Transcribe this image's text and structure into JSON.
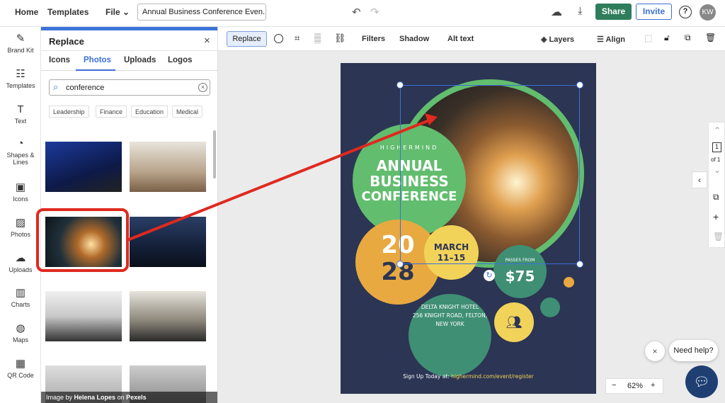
{
  "topbar": {
    "home": "Home",
    "templates": "Templates",
    "file": "File",
    "doc_name": "Annual Business Conference Even...",
    "share": "Share",
    "invite": "Invite",
    "help": "?",
    "avatar": "KW"
  },
  "rail": [
    {
      "label": "Brand Kit",
      "icon": "✎"
    },
    {
      "label": "Templates",
      "icon": "☷"
    },
    {
      "label": "Text",
      "icon": "T"
    },
    {
      "label": "Shapes & Lines",
      "icon": "◔"
    },
    {
      "label": "Icons",
      "icon": "▣"
    },
    {
      "label": "Photos",
      "icon": "▨"
    },
    {
      "label": "Uploads",
      "icon": "☁"
    },
    {
      "label": "Charts",
      "icon": "▥"
    },
    {
      "label": "Maps",
      "icon": "◍"
    },
    {
      "label": "QR Code",
      "icon": "▦"
    }
  ],
  "panel": {
    "title": "Replace",
    "tabs": [
      "Icons",
      "Photos",
      "Uploads",
      "Logos"
    ],
    "active_tab": "Photos",
    "search_value": "conference",
    "chips": [
      "Leadership",
      "Finance",
      "Education",
      "Medical"
    ],
    "credit_prefix": "Image by ",
    "credit_author": "Helena Lopes",
    "credit_mid": " on ",
    "credit_source": "Pexels"
  },
  "toolbar": {
    "replace": "Replace",
    "filters": "Filters",
    "shadow": "Shadow",
    "alt_text": "Alt text",
    "layers": "Layers",
    "align": "Align"
  },
  "poster": {
    "brand": "HIGHERMIND",
    "title1": "ANNUAL",
    "title2": "BUSINESS",
    "title3": "CONFERENCE",
    "year1": "20",
    "year2": "28",
    "month": "MARCH",
    "dates": "11–15",
    "passes_label": "PASSES FROM",
    "price": "$75",
    "hotel1": "DELTA KNIGHT HOTEL",
    "hotel2": "256 KNIGHT ROAD, FELTON,",
    "hotel3": "NEW YORK",
    "signup": "Sign Up Today at: ",
    "url": "highermind.com/event/register"
  },
  "pager": {
    "page": "1",
    "of": "of 1"
  },
  "zoom": {
    "minus": "−",
    "value": "62%",
    "plus": "+"
  },
  "help_bubble": "Need help?",
  "colors": {
    "accent": "#3d74d8",
    "share": "#2e7d5b",
    "navy": "#2c3553",
    "green": "#62bd6e",
    "orange": "#e8a940",
    "yellow": "#f2d35a",
    "teal": "#3f8f74",
    "highlight": "#e0291f"
  }
}
